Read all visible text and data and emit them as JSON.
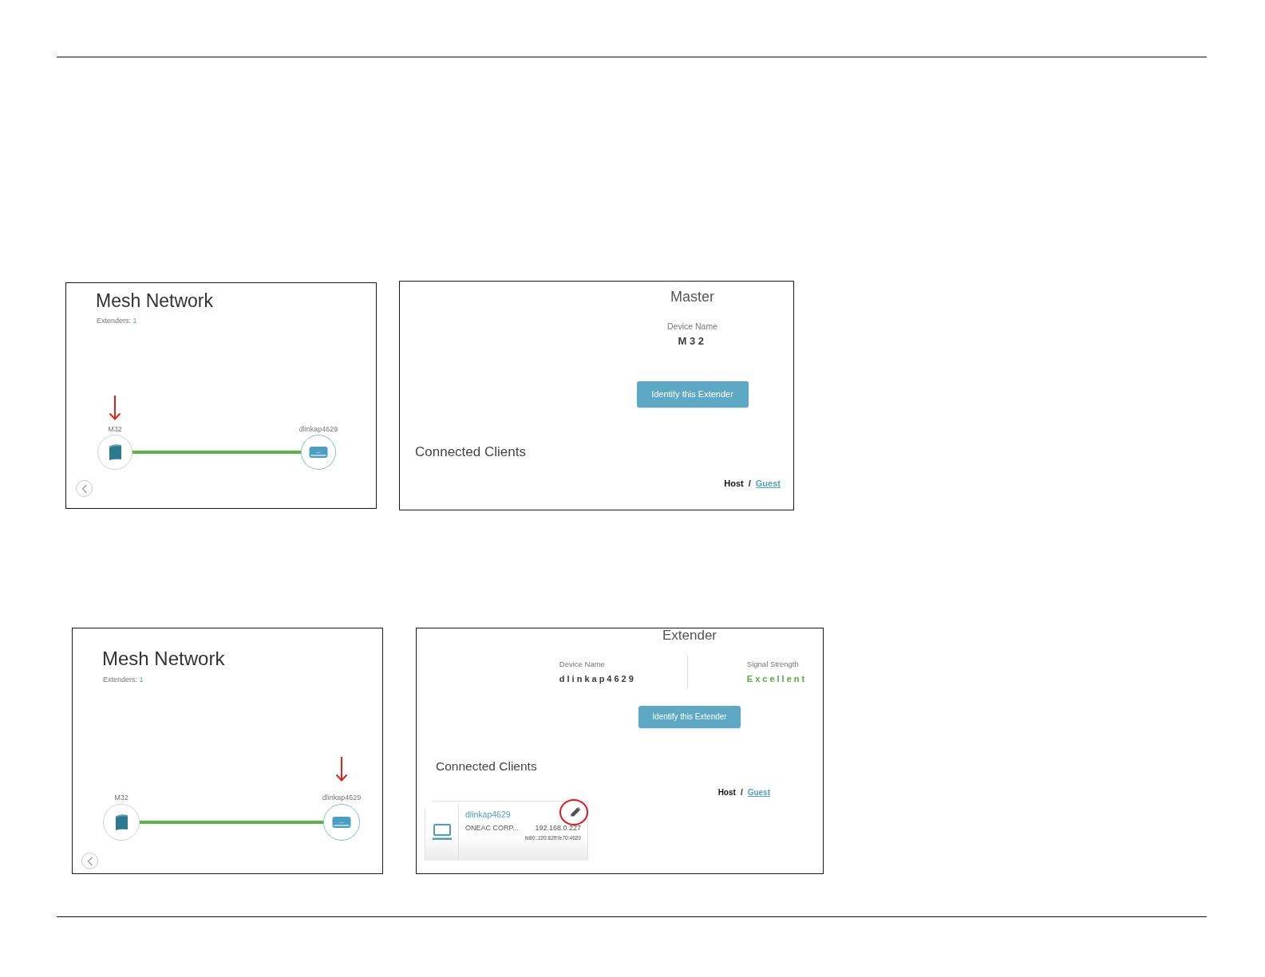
{
  "figures": [
    {
      "mesh_view": {
        "title": "Mesh Network",
        "extenders_label": "Extenders:",
        "extenders_count": "1",
        "nodes": [
          {
            "label": "M32",
            "kind": "master",
            "pointed": true
          },
          {
            "label": "dlinkap4629",
            "kind": "extender",
            "pointed": false
          }
        ]
      },
      "device_view": {
        "heading": "Master",
        "fields": [
          {
            "label": "Device Name",
            "value": "M32",
            "kind": "name"
          }
        ],
        "button": "Identify this Extender",
        "clients_heading": "Connected Clients",
        "filters": [
          {
            "label": "Host",
            "selected": true
          },
          {
            "label": "Guest",
            "selected": false
          }
        ],
        "filter_separator": "/"
      }
    },
    {
      "mesh_view": {
        "title": "Mesh Network",
        "extenders_label": "Extenders:",
        "extenders_count": "1",
        "nodes": [
          {
            "label": "M32",
            "kind": "master",
            "pointed": false
          },
          {
            "label": "dlinkap4629",
            "kind": "extender",
            "pointed": true
          }
        ]
      },
      "device_view": {
        "heading": "Extender",
        "fields": [
          {
            "label": "Device Name",
            "value": "dlinkap4629",
            "kind": "name"
          },
          {
            "label": "Signal Strength",
            "value": "Excellent",
            "kind": "signal"
          }
        ],
        "button": "Identify this Extender",
        "clients_heading": "Connected Clients",
        "filters": [
          {
            "label": "Host",
            "selected": true
          },
          {
            "label": "Guest",
            "selected": false
          }
        ],
        "filter_separator": "/",
        "clients": [
          {
            "name": "dlinkap4629",
            "vendor": "ONEAC CORP...",
            "ipv4": "192.168.0.227",
            "ipv6": "fe80::220:82ff:fe70:4629",
            "edit_circled": true
          }
        ]
      }
    }
  ]
}
